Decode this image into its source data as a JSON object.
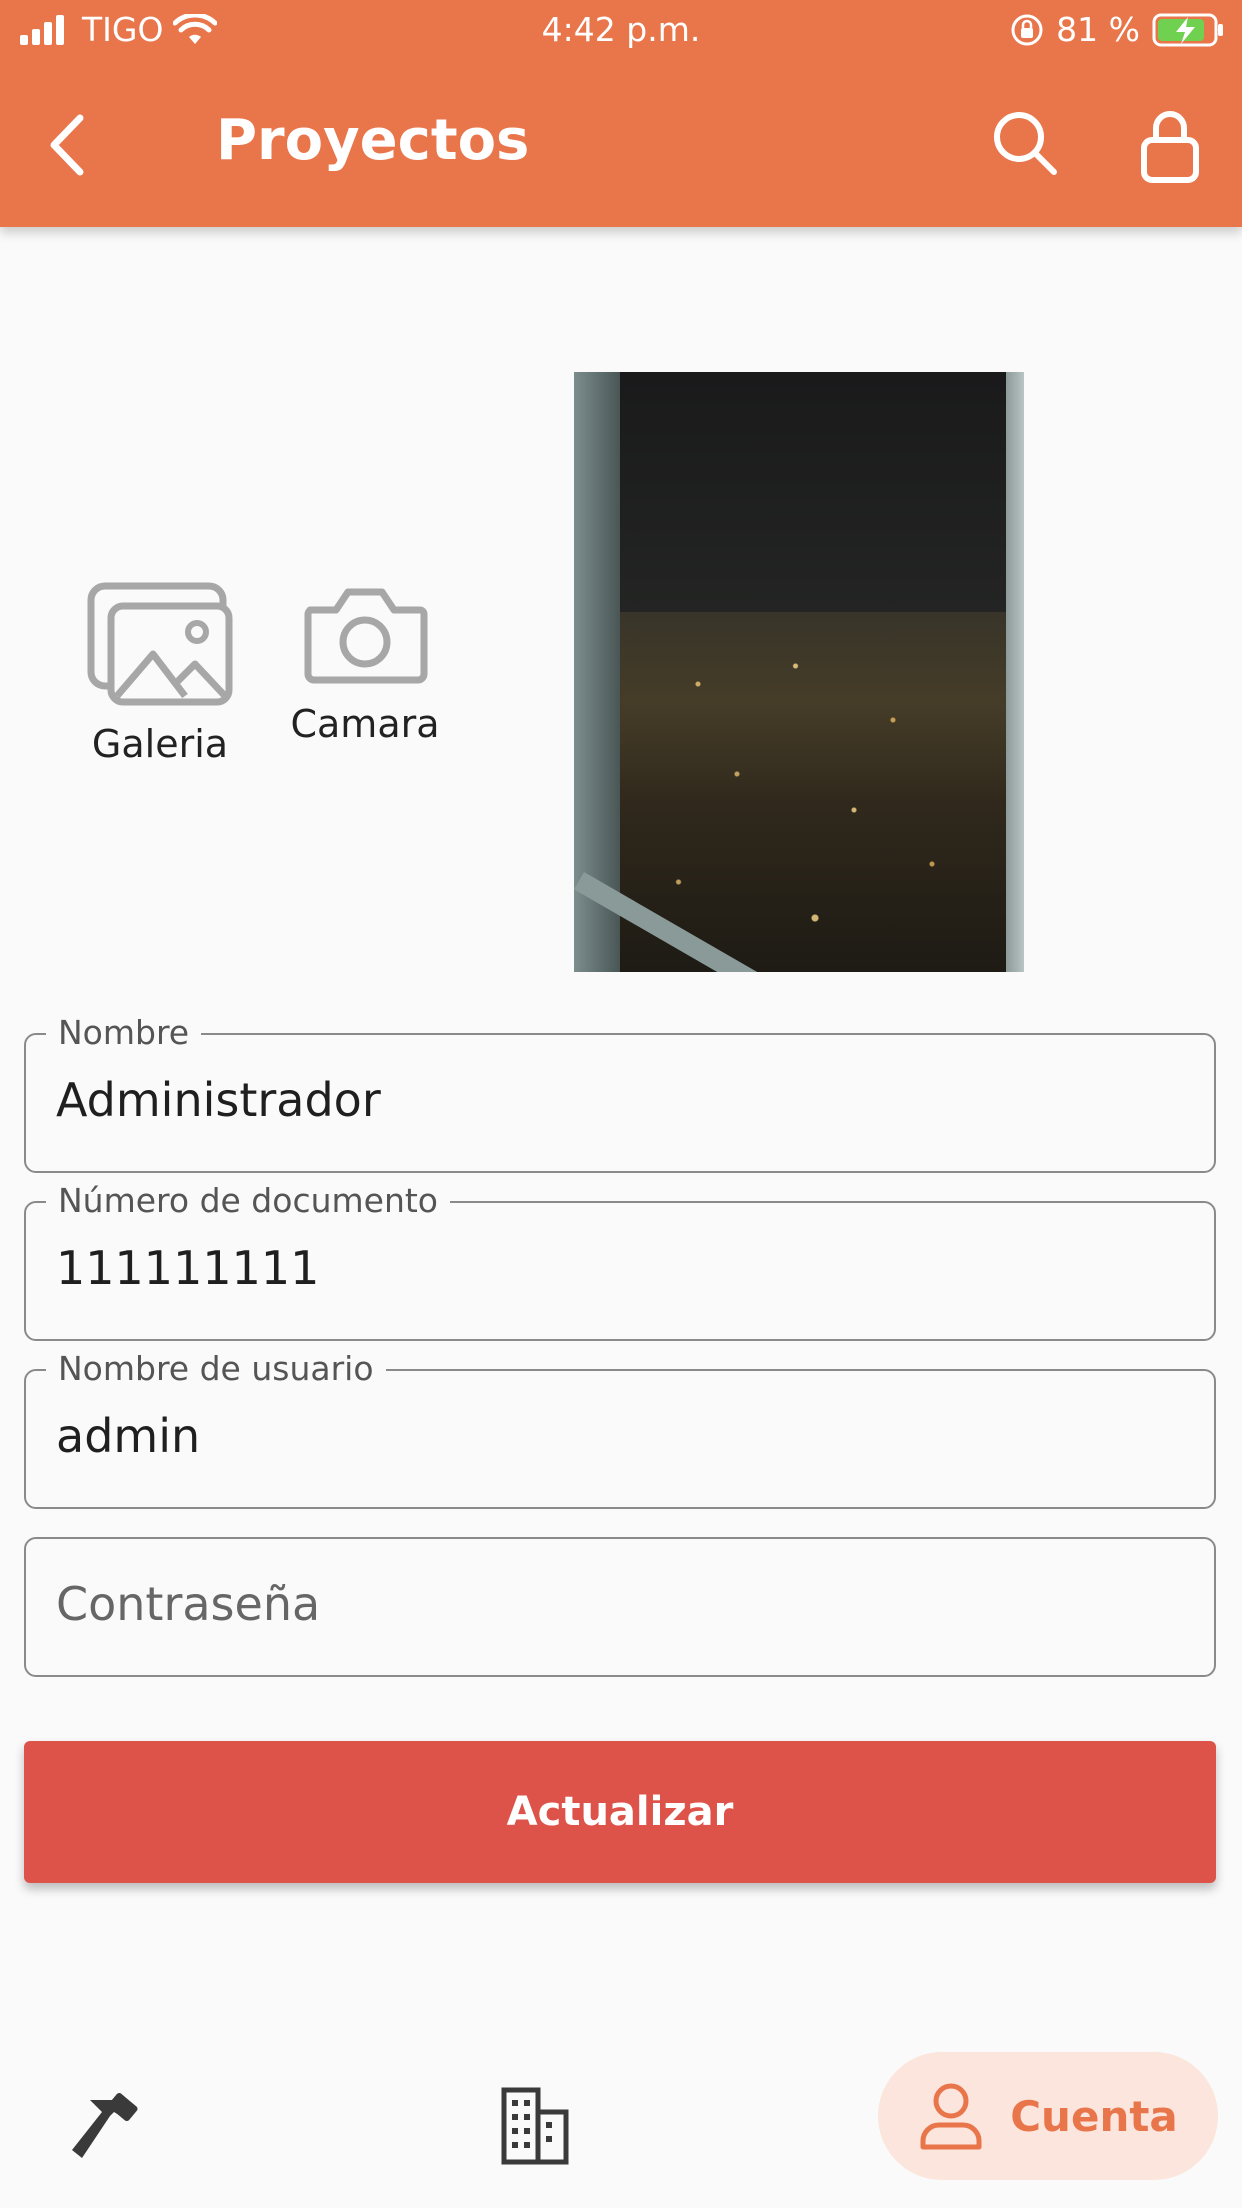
{
  "status_bar": {
    "carrier": "TIGO",
    "time": "4:42 p.m.",
    "battery": "81 %"
  },
  "app_bar": {
    "title": "Proyectos"
  },
  "image_picker": {
    "gallery_label": "Galeria",
    "camera_label": "Camara"
  },
  "form": {
    "name_label": "Nombre",
    "name_value": "Administrador",
    "document_label": "Número de documento",
    "document_value": "111111111",
    "username_label": "Nombre de usuario",
    "username_value": "admin",
    "password_placeholder": "Contraseña"
  },
  "actions": {
    "update_label": "Actualizar"
  },
  "bottom_nav": {
    "account_label": "Cuenta"
  },
  "colors": {
    "primary": "#e9754b",
    "button": "#dd534a",
    "nav_active_bg": "#fbe5dd"
  }
}
